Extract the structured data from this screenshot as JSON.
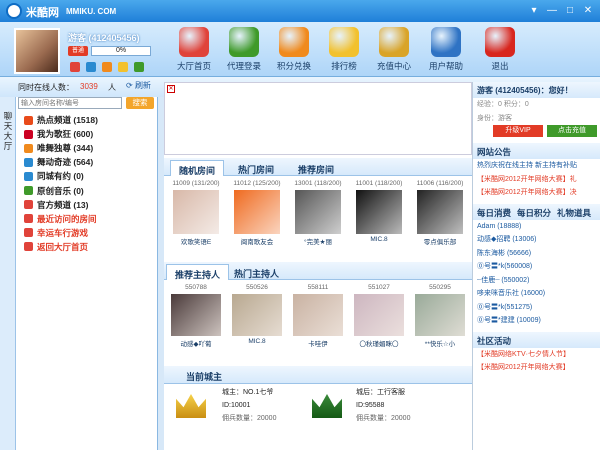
{
  "titlebar": {
    "app_name": "米酷网",
    "domain": "MMIKU. COM",
    "win_buttons": [
      "▾",
      "—",
      "□",
      "✕"
    ]
  },
  "user": {
    "name": "游客 (412405456)",
    "vip_label": "普通",
    "progress_text": "0%",
    "progress": 0
  },
  "nav": [
    {
      "label": "大厅首页",
      "icon": "home-icon",
      "color": "#e0433a"
    },
    {
      "label": "代理登录",
      "icon": "person-icon",
      "color": "#3f9a2a"
    },
    {
      "label": "积分兑换",
      "icon": "coin-exchange-icon",
      "color": "#f08a1d"
    },
    {
      "label": "排行榜",
      "icon": "star-icon",
      "color": "#f2c12e"
    },
    {
      "label": "充值中心",
      "icon": "gold-coins-icon",
      "color": "#d9a429"
    },
    {
      "label": "用户帮助",
      "icon": "help-icon",
      "color": "#2f73c4"
    },
    {
      "label": "退出",
      "icon": "power-icon",
      "color": "#d8261e"
    }
  ],
  "online": {
    "label": "同时在线人数：",
    "count": "3039",
    "unit": "人",
    "refresh": "刷新"
  },
  "search": {
    "placeholder": "输入房间名称/编号",
    "button": "搜索"
  },
  "side_tab": "聊天大厅",
  "channels": [
    {
      "label": "热点频道 (1518)",
      "red": false,
      "icon": "fire-icon",
      "color": "#e94b1a"
    },
    {
      "label": "我为歌狂 (600)",
      "red": false,
      "icon": "music-icon",
      "color": "#c02"
    },
    {
      "label": "唯舞独尊 (344)",
      "red": false,
      "icon": "dance-icon",
      "color": "#f08a1d"
    },
    {
      "label": "舞动奇迹 (564)",
      "red": false,
      "icon": "dance2-icon",
      "color": "#2a8ad0"
    },
    {
      "label": "同城有约 (0)",
      "red": false,
      "icon": "city-icon",
      "color": "#2a8ad0"
    },
    {
      "label": "原创音乐 (0)",
      "red": false,
      "icon": "note-icon",
      "color": "#3f9a2a"
    },
    {
      "label": "官方频道 (13)",
      "red": false,
      "icon": "official-icon",
      "color": "#e0433a"
    },
    {
      "label": "最近访问的房间",
      "red": true,
      "icon": "history-icon",
      "color": "#e0433a"
    },
    {
      "label": "幸运车行游戏",
      "red": true,
      "icon": "car-icon",
      "color": "#e0433a"
    },
    {
      "label": "返回大厅首页",
      "red": true,
      "icon": "back-icon",
      "color": "#e0433a"
    }
  ],
  "room_tabs": [
    "随机房间",
    "热门房间",
    "推荐房间"
  ],
  "rooms": [
    {
      "id": "11009 (131/200)",
      "name": "欢歌笑语E",
      "color": "#d8b8a8"
    },
    {
      "id": "11012 (125/200)",
      "name": "闽南歌友会",
      "color": "#ef6a1f"
    },
    {
      "id": "13001 (118/200)",
      "name": "°完美★丽",
      "color": "#555"
    },
    {
      "id": "11001 (118/200)",
      "name": "MIC.8",
      "color": "#111"
    },
    {
      "id": "11006 (116/200)",
      "name": "零点俱乐部",
      "color": "#222"
    }
  ],
  "host_tabs": [
    "推荐主持人",
    "热门主持人"
  ],
  "hosts": [
    {
      "id": "550788",
      "name": "动感◆吖葡",
      "color": "#4a3a3a"
    },
    {
      "id": "550526",
      "name": "MIC.8",
      "color": "#b8a890"
    },
    {
      "id": "558111",
      "name": "卡哇伊",
      "color": "#c9b2a2"
    },
    {
      "id": "551027",
      "name": "〇秋瑾媚眯〇",
      "color": "#cdb6c0"
    },
    {
      "id": "550295",
      "name": "**快乐☆小",
      "color": "#9a9"
    }
  ],
  "kings": {
    "title": "当前城主",
    "king": {
      "role": "城主：NO.1七爷",
      "id": "ID:10001",
      "troops": "佣兵数量：20000"
    },
    "queen": {
      "role": "城后：工行客服",
      "id": "ID:95588",
      "troops": "佣兵数量：20000"
    }
  },
  "profile": {
    "name": "游客 (412405456)：您好！",
    "points": "经验：0 积分：0",
    "identity": "身份：游客",
    "vip_button": "升级VIP",
    "recharge_button": "点击充值"
  },
  "notice": {
    "title": "网站公告",
    "items": [
      "热烈庆祝在线主持 新主持有补贴",
      "【米酷网2012开年网络大赛】礼",
      "【米酷网2012开年网络大赛】决"
    ]
  },
  "ranking": {
    "tabs": [
      "每日消费",
      "每日积分",
      "礼物道具"
    ],
    "items": [
      "Adam (18888)",
      "动感◆招聘 (13006)",
      "陈东海彬 (56666)",
      "⓪号〓*k(560008)",
      "┈佳鹿┈ (550002)",
      "哆来咪音乐社 (16000)",
      "⓪号〓*k(551275)",
      "⓪号〓*建建 (10009)"
    ]
  },
  "community": {
    "title": "社区活动",
    "items": [
      "【米酷网络KTV·七夕情人节】",
      "【米酷网2012开年网络大赛】"
    ]
  }
}
